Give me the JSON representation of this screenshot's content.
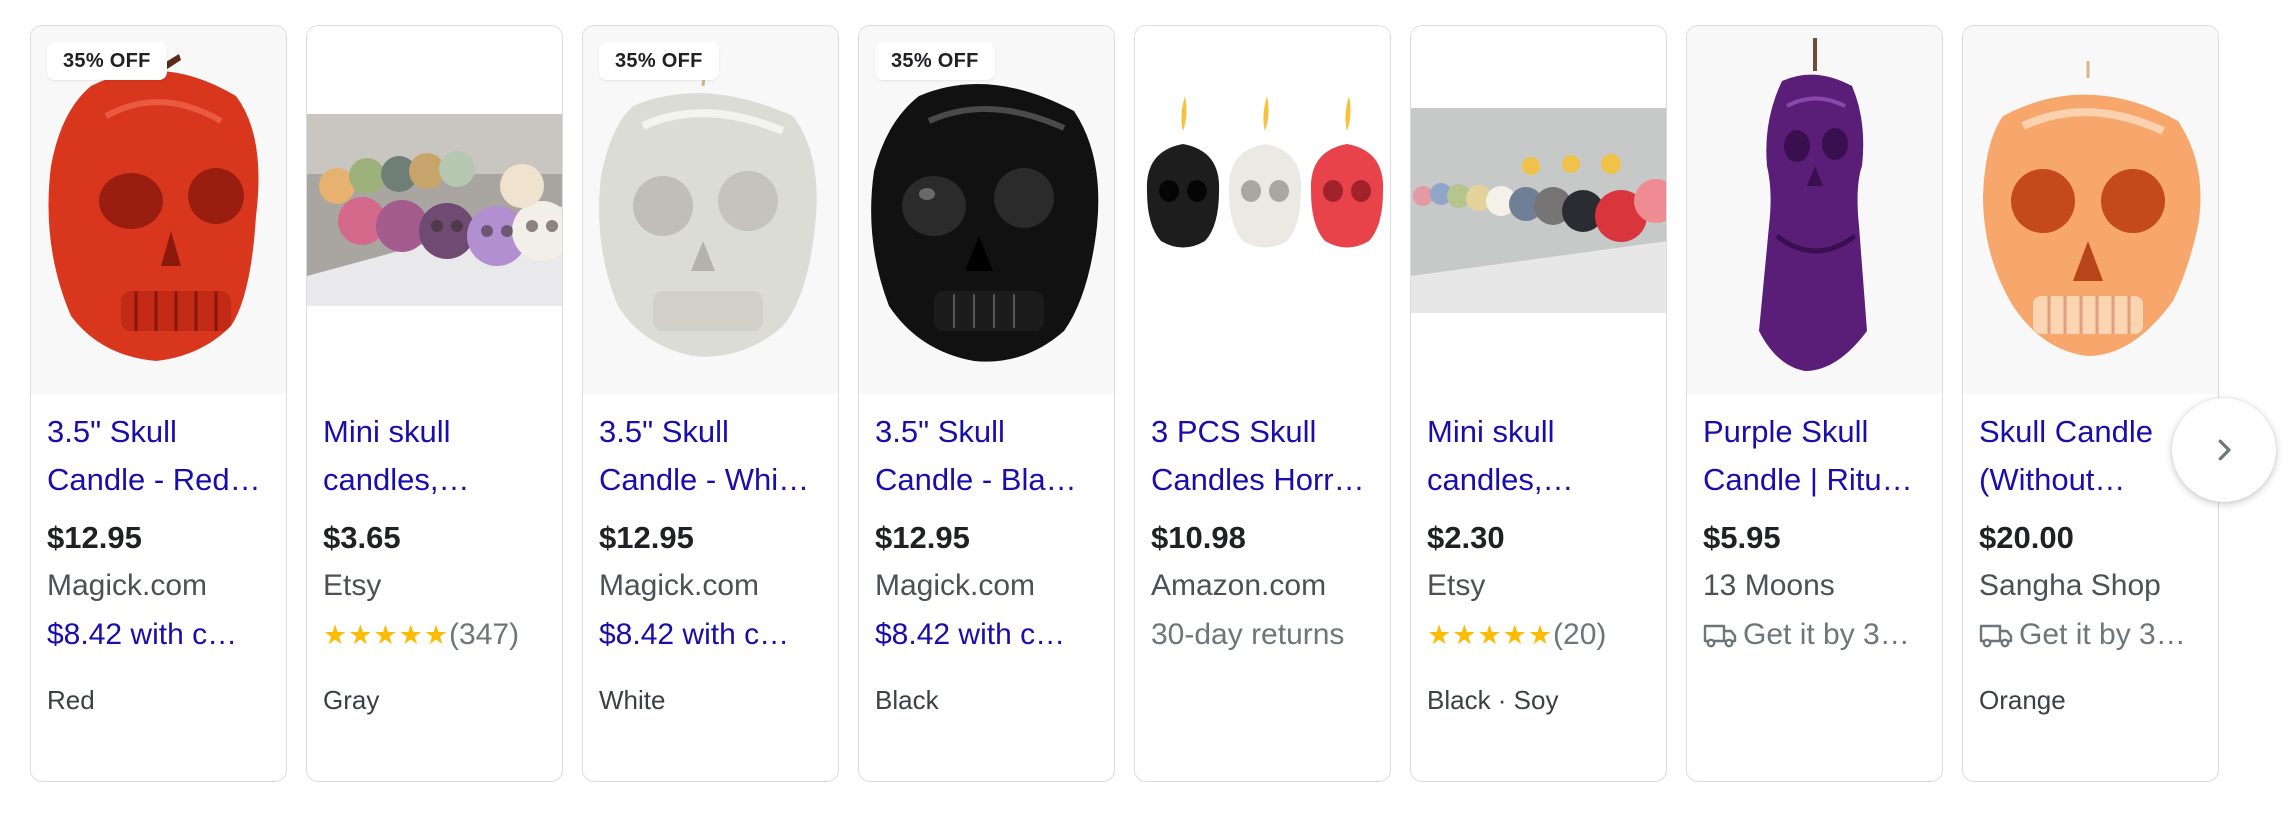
{
  "products": [
    {
      "badge": "35% OFF",
      "title": "3.5\" Skull Candle - Red…",
      "price": "$12.95",
      "store": "Magick.com",
      "extra": "$8.42 with c…",
      "extra_type": "promo",
      "variant": "Red",
      "image": "skull-red"
    },
    {
      "title": "Mini skull candles,…",
      "price": "$3.65",
      "store": "Etsy",
      "rating": "★★★★★",
      "reviews": "(347)",
      "extra_type": "rating",
      "variant": "Gray",
      "image": "mini-skulls-row"
    },
    {
      "badge": "35% OFF",
      "title": "3.5\" Skull Candle - Whi…",
      "price": "$12.95",
      "store": "Magick.com",
      "extra": "$8.42 with c…",
      "extra_type": "promo",
      "variant": "White",
      "image": "skull-white"
    },
    {
      "badge": "35% OFF",
      "title": "3.5\" Skull Candle - Bla…",
      "price": "$12.95",
      "store": "Magick.com",
      "extra": "$8.42 with c…",
      "extra_type": "promo",
      "variant": "Black",
      "image": "skull-black"
    },
    {
      "title": "3 PCS Skull Candles Horr…",
      "price": "$10.98",
      "store": "Amazon.com",
      "extra": "30-day returns",
      "extra_type": "returns",
      "variant": "",
      "image": "three-lit-skulls"
    },
    {
      "title": "Mini skull candles,…",
      "price": "$2.30",
      "store": "Etsy",
      "rating": "★★★★★",
      "reviews": "(20)",
      "extra_type": "rating",
      "variant": "Black · Soy",
      "image": "mini-skulls-row-2"
    },
    {
      "title": "Purple Skull Candle | Ritu…",
      "price": "$5.95",
      "store": "13 Moons",
      "extra": "Get it by 3…",
      "extra_type": "shipping",
      "variant": "",
      "image": "skull-purple"
    },
    {
      "title": "Skull Candle (Without…",
      "price": "$20.00",
      "store": "Sangha Shop",
      "extra": "Get it by 3…",
      "extra_type": "shipping",
      "variant": "Orange",
      "image": "skull-orange"
    }
  ],
  "colors": {
    "link": "#1a0dab",
    "price": "#202124",
    "muted": "#70757a",
    "star": "#fbbc04"
  },
  "icons": {
    "next": "chevron-right-icon",
    "shipping": "truck-icon"
  }
}
